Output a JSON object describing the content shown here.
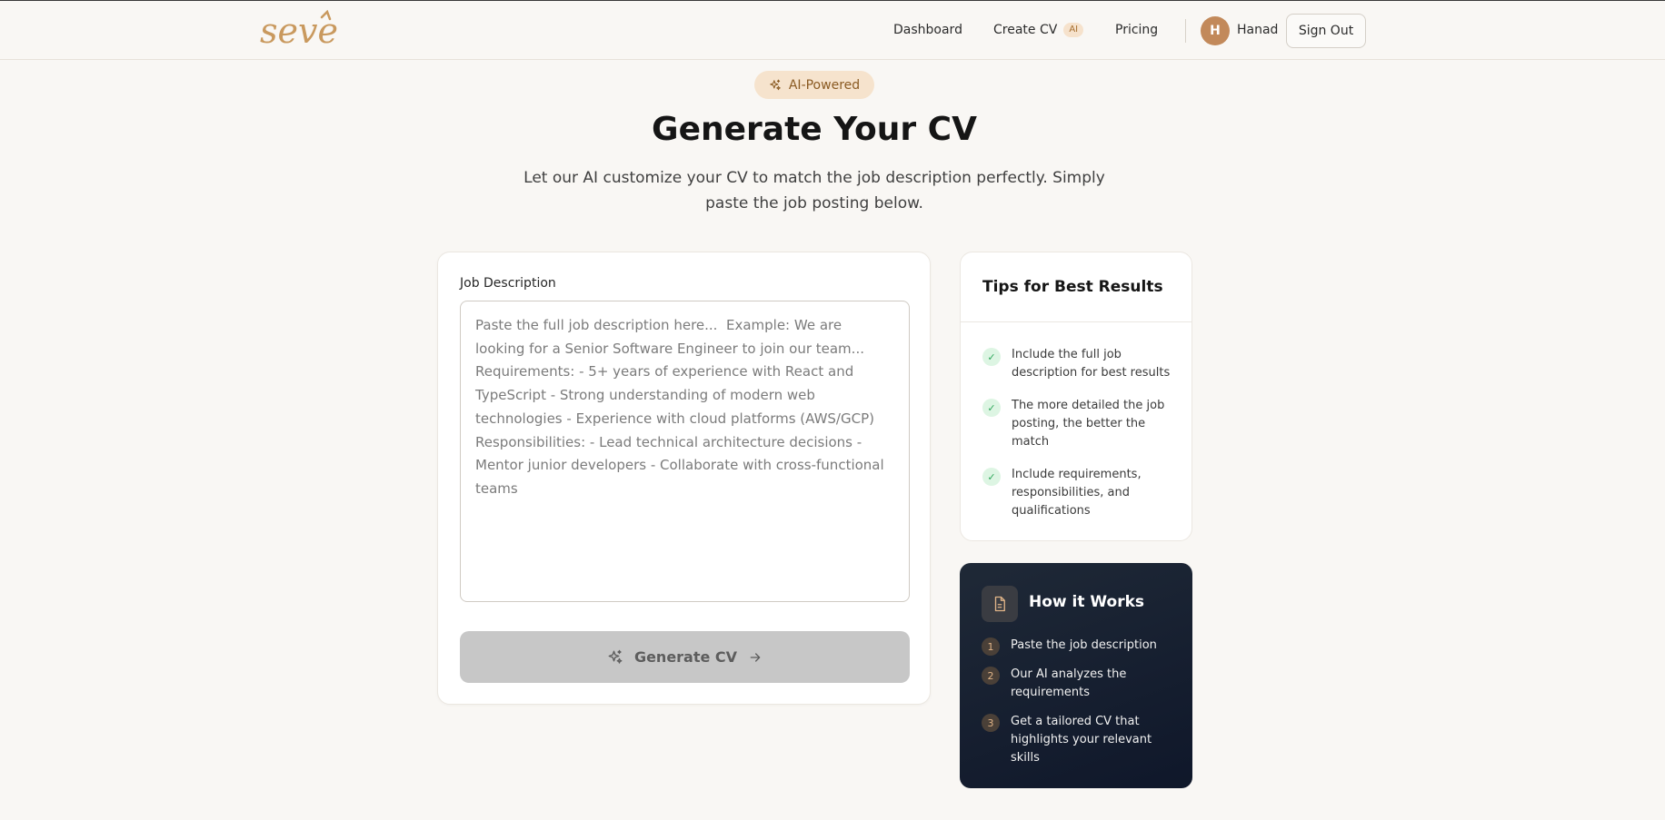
{
  "header": {
    "logo_text": "seve",
    "nav": {
      "dashboard": "Dashboard",
      "create_cv": "Create CV",
      "create_cv_badge": "AI",
      "pricing": "Pricing"
    },
    "user": {
      "initial": "H",
      "name": "Hanad"
    },
    "sign_out": "Sign Out"
  },
  "hero": {
    "badge": "AI-Powered",
    "title": "Generate Your CV",
    "subtitle": "Let our AI customize your CV to match the job description perfectly. Simply paste the job posting below."
  },
  "form": {
    "label": "Job Description",
    "value": "",
    "placeholder": "Paste the full job description here...  Example: We are looking for a Senior Software Engineer to join our team...  Requirements: - 5+ years of experience with React and TypeScript - Strong understanding of modern web technologies - Experience with cloud platforms (AWS/GCP)  Responsibilities: - Lead technical architecture decisions - Mentor junior developers - Collaborate with cross-functional teams",
    "submit_label": "Generate CV"
  },
  "tips": {
    "title": "Tips for Best Results",
    "items": [
      "Include the full job description for best results",
      "The more detailed the job posting, the better the match",
      "Include requirements, responsibilities, and qualifications"
    ]
  },
  "how_it_works": {
    "title": "How it Works",
    "steps": [
      {
        "num": "1",
        "text": "Paste the job description"
      },
      {
        "num": "2",
        "text": "Our AI analyzes the requirements"
      },
      {
        "num": "3",
        "text": "Get a tailored CV that highlights your relevant skills"
      }
    ]
  },
  "colors": {
    "background": "#f9f7f4",
    "brand": "#c9995e",
    "badge_bg": "#f6e3cd",
    "button_disabled": "#c7c7c7",
    "dark_card": "#111827",
    "check_green": "#2fa75b"
  },
  "icons": {
    "badge": "sparkles-icon",
    "button": "sparkles-icon",
    "button_trailing": "arrow-right-icon",
    "tips": "check-icon",
    "how": "document-icon"
  }
}
